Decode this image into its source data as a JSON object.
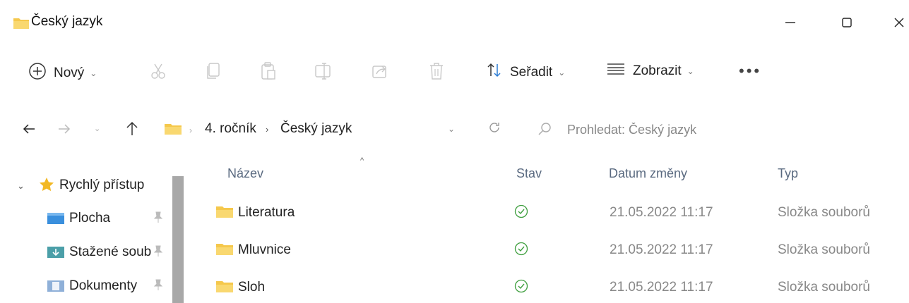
{
  "window": {
    "title": "Český jazyk",
    "icon": "folder-icon"
  },
  "toolbar": {
    "new_label": "Nový",
    "sort_label": "Seřadit",
    "view_label": "Zobrazit",
    "more_label": "•••",
    "actions": [
      "cut-icon",
      "copy-icon",
      "paste-icon",
      "rename-icon",
      "share-icon",
      "delete-icon"
    ]
  },
  "address": {
    "crumbs": [
      "4. ročník",
      "Český jazyk"
    ],
    "search_placeholder": "Prohledat: Český jazyk"
  },
  "sidebar": {
    "quick_access_label": "Rychlý přístup",
    "items": [
      {
        "label": "Plocha",
        "icon": "desktop-folder-icon"
      },
      {
        "label": "Stažené soub",
        "icon": "downloads-folder-icon"
      },
      {
        "label": "Dokumenty",
        "icon": "documents-folder-icon"
      }
    ]
  },
  "columns": {
    "name": "Název",
    "status": "Stav",
    "date": "Datum změny",
    "type": "Typ"
  },
  "files": [
    {
      "name": "Literatura",
      "date": "21.05.2022 11:17",
      "type": "Složka souborů"
    },
    {
      "name": "Mluvnice",
      "date": "21.05.2022 11:17",
      "type": "Složka souborů"
    },
    {
      "name": "Sloh",
      "date": "21.05.2022 11:17",
      "type": "Složka souborů"
    }
  ],
  "colors": {
    "folder_yellow": "#f5c84c",
    "status_green": "#3f9f3f",
    "muted_text": "#888888"
  }
}
